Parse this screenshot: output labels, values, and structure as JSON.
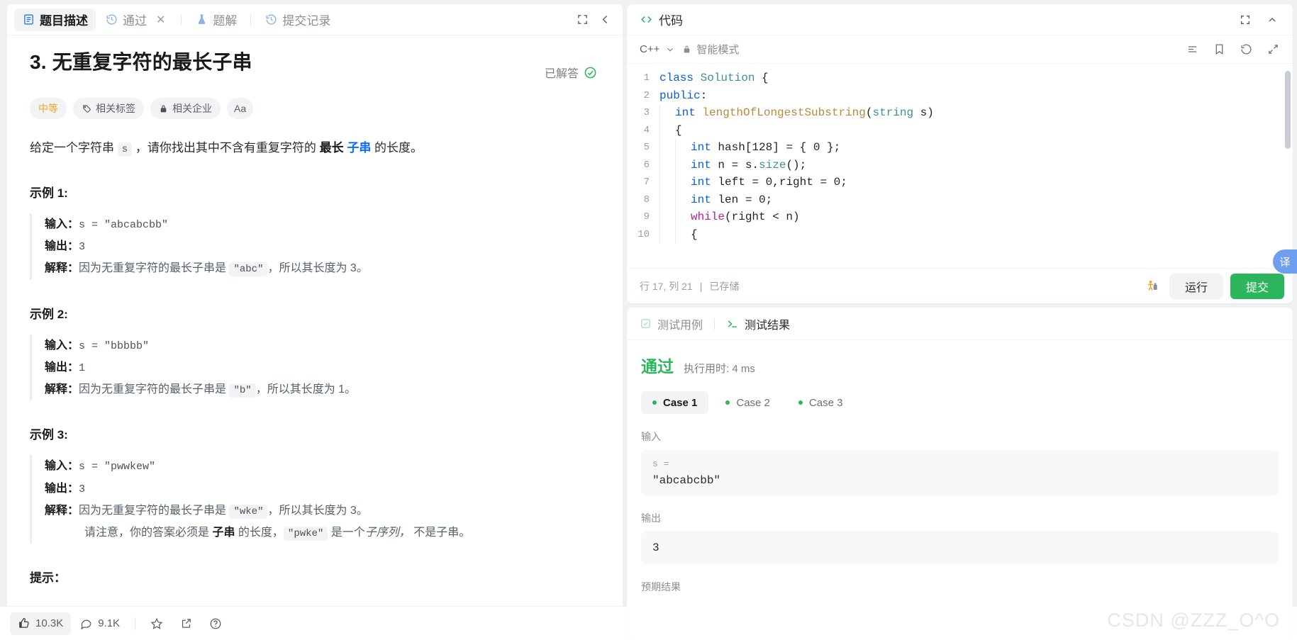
{
  "left": {
    "tabs": [
      {
        "label": "题目描述",
        "icon": "document-icon",
        "active": true,
        "closable": false
      },
      {
        "label": "通过",
        "icon": "history-icon",
        "active": false,
        "closable": true
      },
      {
        "label": "题解",
        "icon": "flask-icon",
        "active": false,
        "closable": false
      },
      {
        "label": "提交记录",
        "icon": "history-icon",
        "active": false,
        "closable": false
      }
    ],
    "expand_label": "全屏",
    "collapse_label": "收起",
    "problem": {
      "title": "3. 无重复字符的最长子串",
      "solved_label": "已解答",
      "difficulty": "中等",
      "tags_label": "相关标签",
      "companies_label": "相关企业",
      "translate_label": "Aa",
      "description_prefix": "给定一个字符串 ",
      "description_var": "s",
      "description_mid": " ，请你找出其中不含有重复字符的 ",
      "description_bold": "最长",
      "description_blue": "子串",
      "description_suffix": " 的长度。",
      "examples": [
        {
          "title": "示例 1:",
          "input_label": "输入：",
          "input_value": "s = \"abcabcbb\"",
          "output_label": "输出：",
          "output_value": "3",
          "explain_label": "解释：",
          "explain_pre": "因为无重复字符的最长子串是 ",
          "explain_chip": "\"abc\"",
          "explain_post": "，所以其长度为 3。",
          "explain_line2": "",
          "explain_line2_chip": "",
          "explain_line2_post": ""
        },
        {
          "title": "示例 2:",
          "input_label": "输入：",
          "input_value": "s = \"bbbbb\"",
          "output_label": "输出：",
          "output_value": "1",
          "explain_label": "解释：",
          "explain_pre": "因为无重复字符的最长子串是 ",
          "explain_chip": "\"b\"",
          "explain_post": "，所以其长度为 1。",
          "explain_line2": "",
          "explain_line2_chip": "",
          "explain_line2_post": ""
        },
        {
          "title": "示例 3:",
          "input_label": "输入：",
          "input_value": "s = \"pwwkew\"",
          "output_label": "输出：",
          "output_value": "3",
          "explain_label": "解释：",
          "explain_pre": "因为无重复字符的最长子串是 ",
          "explain_chip": "\"wke\"",
          "explain_post": "，所以其长度为 3。",
          "explain_line2_a": "请注意，你的答案必须是 ",
          "explain_line2_bold": "子串",
          "explain_line2_b": " 的长度，",
          "explain_line2_chip": "\"pwke\"",
          "explain_line2_c": " 是一个",
          "explain_line2_italic": "子序列，",
          "explain_line2_d": " 不是子串。"
        }
      ],
      "hints_title": "提示："
    },
    "bottombar": {
      "likes": "10.3K",
      "comments": "9.1K",
      "star_icon": "star-icon",
      "share_icon": "share-icon",
      "help_icon": "help-icon"
    }
  },
  "right": {
    "code_panel": {
      "title": "代码",
      "code_icon": "code-brackets-icon",
      "expand_icon": "expand-icon",
      "collapse_icon": "chevron-up-icon",
      "language": "C++",
      "smart_mode": "智能模式",
      "lock_icon": "lock-icon",
      "toolbar_icons": [
        "format-icon",
        "bookmark-icon",
        "reset-icon",
        "fullscreen-icon"
      ],
      "lines": [
        {
          "n": "1",
          "tokens": [
            {
              "t": "class ",
              "c": "k-blue"
            },
            {
              "t": "Solution",
              "c": "k-class"
            },
            {
              "t": " {",
              "c": ""
            }
          ],
          "indent": 0
        },
        {
          "n": "2",
          "tokens": [
            {
              "t": "public",
              "c": "k-blue"
            },
            {
              "t": ":",
              "c": ""
            }
          ],
          "indent": 0
        },
        {
          "n": "3",
          "tokens": [
            {
              "t": "int",
              "c": "k-type"
            },
            {
              "t": " ",
              "c": ""
            },
            {
              "t": "lengthOfLongestSubstring",
              "c": "k-fn"
            },
            {
              "t": "(",
              "c": ""
            },
            {
              "t": "string",
              "c": "k-class"
            },
            {
              "t": " s)",
              "c": ""
            }
          ],
          "indent": 1
        },
        {
          "n": "4",
          "tokens": [
            {
              "t": "{",
              "c": ""
            }
          ],
          "indent": 1
        },
        {
          "n": "5",
          "tokens": [
            {
              "t": "int",
              "c": "k-type"
            },
            {
              "t": " hash[",
              "c": ""
            },
            {
              "t": "128",
              "c": "k-num"
            },
            {
              "t": "] = { ",
              "c": ""
            },
            {
              "t": "0",
              "c": "k-num"
            },
            {
              "t": " };",
              "c": ""
            }
          ],
          "indent": 2
        },
        {
          "n": "6",
          "tokens": [
            {
              "t": "int",
              "c": "k-type"
            },
            {
              "t": " n = s.",
              "c": ""
            },
            {
              "t": "size",
              "c": "k-class"
            },
            {
              "t": "();",
              "c": ""
            }
          ],
          "indent": 2
        },
        {
          "n": "7",
          "tokens": [
            {
              "t": "int",
              "c": "k-type"
            },
            {
              "t": " left = ",
              "c": ""
            },
            {
              "t": "0",
              "c": "k-num"
            },
            {
              "t": ",right = ",
              "c": ""
            },
            {
              "t": "0",
              "c": "k-num"
            },
            {
              "t": ";",
              "c": ""
            }
          ],
          "indent": 2
        },
        {
          "n": "8",
          "tokens": [
            {
              "t": "int",
              "c": "k-type"
            },
            {
              "t": " len = ",
              "c": ""
            },
            {
              "t": "0",
              "c": "k-num"
            },
            {
              "t": ";",
              "c": ""
            }
          ],
          "indent": 2
        },
        {
          "n": "9",
          "tokens": [
            {
              "t": "while",
              "c": "k-purple"
            },
            {
              "t": "(right < n)",
              "c": ""
            }
          ],
          "indent": 2
        },
        {
          "n": "10",
          "tokens": [
            {
              "t": "{",
              "c": ""
            }
          ],
          "indent": 2
        }
      ],
      "status": "行 17, 列 21",
      "status_sep": "|",
      "saved": "已存储",
      "debug_icon": "debug-run-icon",
      "run_label": "运行",
      "submit_label": "提交"
    },
    "test_panel": {
      "tabs": [
        {
          "label": "测试用例",
          "icon": "check-square-icon",
          "active": false
        },
        {
          "label": "测试结果",
          "icon": "terminal-icon",
          "active": true
        }
      ],
      "verdict": "通过",
      "runtime_label": "执行用时: 4 ms",
      "cases": [
        {
          "label": "Case 1",
          "active": true
        },
        {
          "label": "Case 2",
          "active": false
        },
        {
          "label": "Case 3",
          "active": false
        }
      ],
      "input_label": "输入",
      "input_key": "s =",
      "input_value": "\"abcabcbb\"",
      "output_label": "输出",
      "output_value": "3",
      "expected_label": "预期结果"
    },
    "float_button": "译"
  },
  "watermark": "CSDN @ZZZ_O^O",
  "colors": {
    "accent_green": "#2db55d",
    "link_blue": "#0b6cff",
    "difficulty_medium": "#f0a32e"
  }
}
